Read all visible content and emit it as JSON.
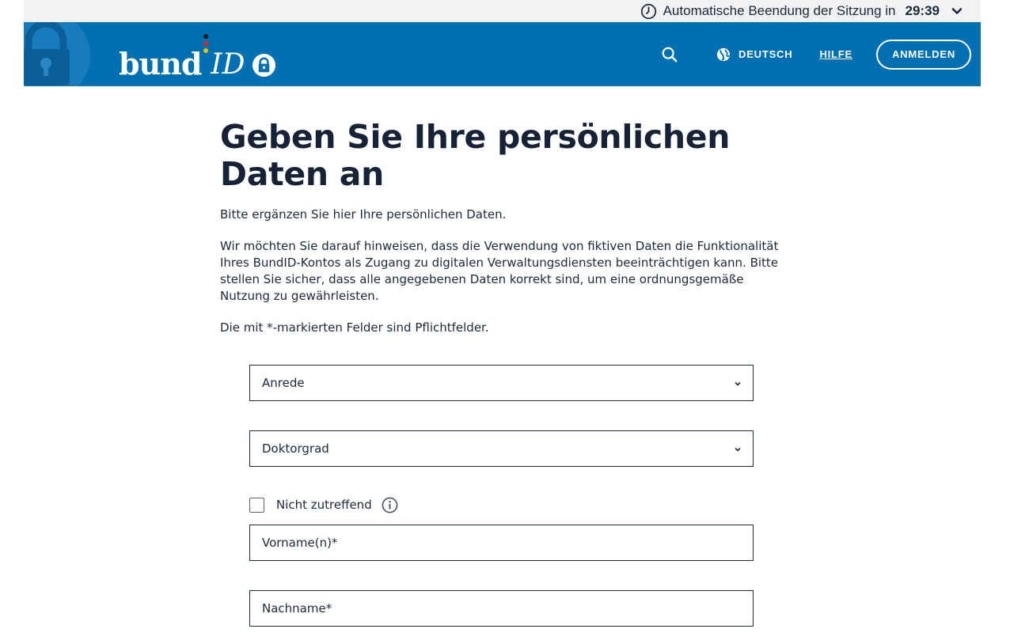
{
  "session": {
    "label": "Automatische Beendung der Sitzung in",
    "time": "29:39",
    "icons": {
      "clock": "clock-icon",
      "toggle": "chevron-down-icon"
    }
  },
  "header": {
    "brand_color": "#0070b3",
    "logo": {
      "word": "bund",
      "suffix": "ID"
    },
    "search_icon": "search-icon",
    "language": "DEUTSCH",
    "help": "HILFE",
    "login": "ANMELDEN"
  },
  "main": {
    "title": "Geben Sie Ihre persönlichen Daten an",
    "intro": "Bitte ergänzen Sie hier Ihre persönlichen Daten.",
    "notice": "Wir möchten Sie darauf hinweisen, dass die Verwendung von fiktiven Daten die Funktionalität Ihres BundID-Kontos als Zugang zu digitalen Verwaltungsdiensten beeinträchtigen kann. Bitte stellen Sie sicher, dass alle angegebenen Daten korrekt sind, um eine ordnungsgemäße Nutzung zu gewährleisten.",
    "required_hint": "Die mit *-markierten Felder sind Pflichtfelder."
  },
  "form": {
    "salutation": {
      "selected": "Anrede"
    },
    "degree": {
      "selected": "Doktorgrad"
    },
    "not_applicable": {
      "label": "Nicht zutreffend",
      "checked": false
    },
    "first_name": {
      "placeholder": "Vorname(n)*",
      "value": ""
    },
    "last_name": {
      "placeholder": "Nachname*",
      "value": ""
    }
  }
}
